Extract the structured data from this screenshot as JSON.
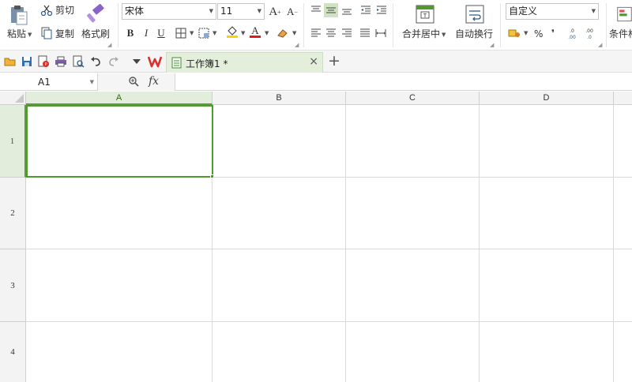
{
  "ribbon": {
    "paste_label": "粘贴",
    "cut_label": "剪切",
    "copy_label": "复制",
    "format_painter_label": "格式刷",
    "font_name": "宋体",
    "font_size": "11",
    "merge_center_label": "合并居中",
    "wrap_text_label": "自动换行",
    "number_format": "自定义",
    "percent_symbol": "%",
    "comma_symbol": "❜",
    "conditional_format_label": "条件格"
  },
  "document": {
    "tab_name": "工作簿1 *",
    "close_symbol": "×",
    "new_tab_symbol": "+"
  },
  "formula_bar": {
    "cell_reference": "A1",
    "fx_label": "fx",
    "formula_value": ""
  },
  "sheet": {
    "columns": [
      "A",
      "B",
      "C",
      "D"
    ],
    "rows": [
      "1",
      "2",
      "3",
      "4"
    ],
    "active_cell": "A1"
  },
  "colors": {
    "accent_green": "#4e9a2c",
    "selected_header": "#e2eedb",
    "wps_red": "#d9302b"
  }
}
